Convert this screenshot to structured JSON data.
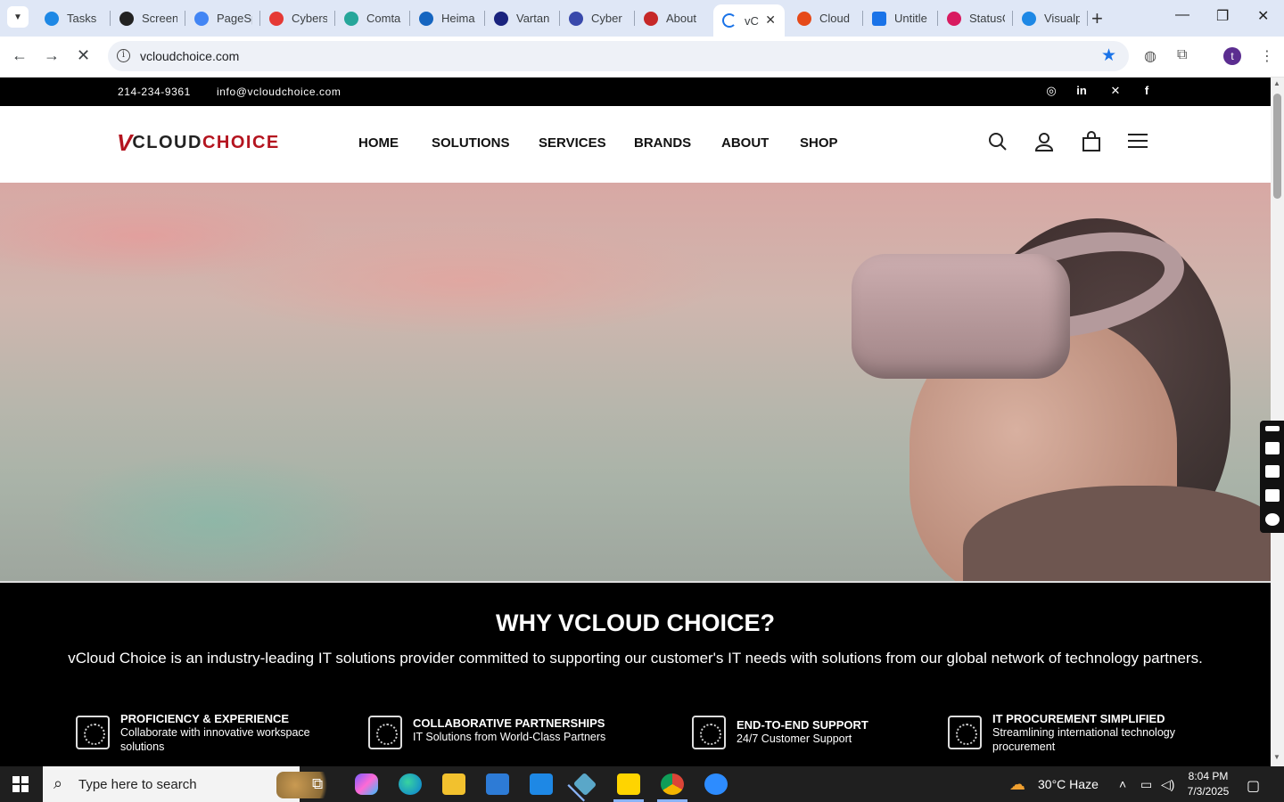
{
  "browser": {
    "tabs": [
      {
        "title": "Tasks",
        "color": "#1e88e5"
      },
      {
        "title": "Screen",
        "color": "#222222"
      },
      {
        "title": "PageSp",
        "color": "#4285f4"
      },
      {
        "title": "Cybers",
        "color": "#e53935"
      },
      {
        "title": "Comta",
        "color": "#26a69a"
      },
      {
        "title": "Heima",
        "color": "#1565c0"
      },
      {
        "title": "Vartan",
        "color": "#1a237e"
      },
      {
        "title": "Cyber",
        "color": "#3949ab"
      },
      {
        "title": "About",
        "color": "#c62828"
      },
      {
        "title": "vC",
        "color": "#1a73e8",
        "active": true
      },
      {
        "title": "Cloud",
        "color": "#e64a19"
      },
      {
        "title": "Untitle",
        "color": "#1a73e8"
      },
      {
        "title": "StatusC",
        "color": "#d81b60"
      },
      {
        "title": "Visualp",
        "color": "#1e88e5"
      }
    ],
    "url": "vcloudchoice.com",
    "profile_initial": "t"
  },
  "site": {
    "phone": "214-234-9361",
    "email": "info@vcloudchoice.com",
    "social": [
      "instagram",
      "linkedin",
      "x",
      "facebook"
    ],
    "logo": {
      "v": "V",
      "w1": "CLOUD",
      "w2": "CHOICE"
    },
    "nav": [
      "HOME",
      "SOLUTIONS",
      "SERVICES",
      "BRANDS",
      "ABOUT",
      "SHOP"
    ],
    "why": {
      "title": "WHY VCLOUD CHOICE?",
      "description": "vCloud Choice is an industry-leading IT solutions provider committed to supporting our customer's IT needs with solutions from our global network of technology partners.",
      "features": [
        {
          "title": "PROFICIENCY & EXPERIENCE",
          "subtitle": "Collaborate with innovative workspace solutions"
        },
        {
          "title": "COLLABORATIVE PARTNERSHIPS",
          "subtitle": "IT Solutions from World-Class Partners"
        },
        {
          "title": "END-TO-END SUPPORT",
          "subtitle": "24/7 Customer Support"
        },
        {
          "title": "IT PROCUREMENT SIMPLIFIED",
          "subtitle": "Streamlining international technology procurement"
        }
      ]
    }
  },
  "taskbar": {
    "search_placeholder": "Type here to search",
    "weather": "30°C  Haze",
    "time": "8:04 PM",
    "date": "7/3/2025"
  }
}
